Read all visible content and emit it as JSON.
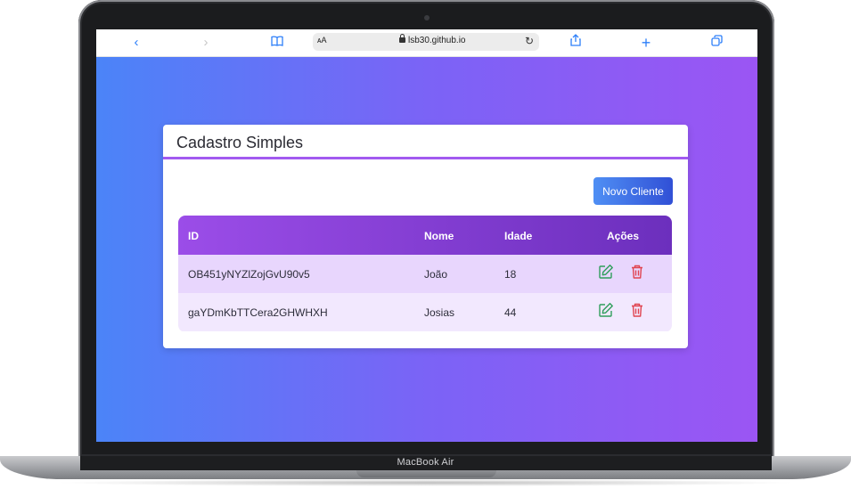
{
  "device": {
    "label": "MacBook Air"
  },
  "browser": {
    "url": "lsb30.github.io",
    "aa_label": "ᴀA",
    "icons": [
      "back-icon",
      "forward-icon",
      "bookmarks-icon",
      "lock-icon",
      "reload-icon",
      "share-icon",
      "new-tab-icon",
      "tabs-icon"
    ]
  },
  "card": {
    "title": "Cadastro Simples",
    "new_button": "Novo Cliente"
  },
  "table": {
    "headers": {
      "id": "ID",
      "nome": "Nome",
      "idade": "Idade",
      "acoes": "Ações"
    },
    "rows": [
      {
        "id": "OB451yNYZlZojGvU90v5",
        "nome": "João",
        "idade": "18"
      },
      {
        "id": "gaYDmKbTTCera2GHWHXH",
        "nome": "Josias",
        "idade": "44"
      }
    ]
  },
  "colors": {
    "gradient_start": "#4b84f8",
    "gradient_end": "#9b55f3",
    "header_start": "#9b4de8",
    "header_end": "#6c2fbd",
    "edit": "#2f9e5b",
    "delete": "#e0434f"
  }
}
